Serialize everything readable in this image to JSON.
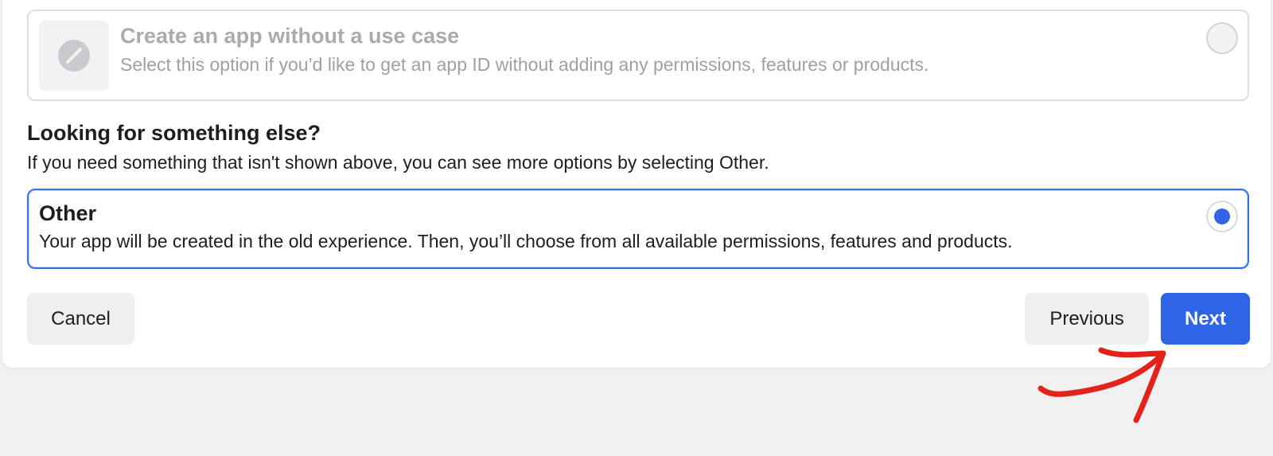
{
  "option_no_use_case": {
    "title": "Create an app without a use case",
    "description": "Select this option if you’d like to get an app ID without adding any permissions, features or products.",
    "selected": false,
    "icon": "disabled-slash-icon"
  },
  "section": {
    "heading": "Looking for something else?",
    "description": "If you need something that isn't shown above, you can see more options by selecting Other."
  },
  "option_other": {
    "title": "Other",
    "description": "Your app will be created in the old experience. Then, you’ll choose from all available permissions, features and products.",
    "selected": true
  },
  "footer": {
    "cancel_label": "Cancel",
    "previous_label": "Previous",
    "next_label": "Next"
  },
  "colors": {
    "accent": "#2f64e6",
    "annotation_arrow": "#e2231a"
  }
}
